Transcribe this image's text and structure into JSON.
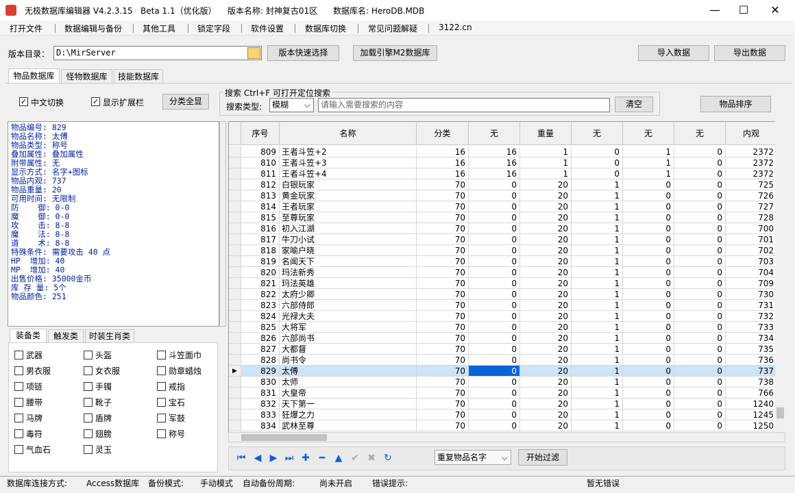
{
  "window": {
    "title": "无极数据库编辑器 V4.2.3.15",
    "beta": "Beta 1.1（优化版）",
    "version_name": "版本名称: 封神复古01区",
    "db_name": "数据库名: HeroDB.MDB",
    "min": "—",
    "max": "☐",
    "close": "✕"
  },
  "menu": [
    "打开文件",
    "数据编辑与备份",
    "其他工具",
    "锁定字段",
    "软件设置",
    "数据库切换",
    "常见问题解疑",
    "3122.cn"
  ],
  "toolbar": {
    "dir_label": "版本目录：",
    "dir_value": "D:\\MirServer",
    "quick_select": "版本快速选择",
    "load_m2": "加载引擎M2数据库",
    "import": "导入数据",
    "export": "导出数据"
  },
  "tabs": [
    "物品数据库",
    "怪物数据库",
    "技能数据库"
  ],
  "options": {
    "chinese": "中文切换",
    "ext": "显示扩展栏",
    "category_all": "分类全显"
  },
  "search": {
    "group_title": "搜索  Ctrl+F 可打开定位搜索",
    "type_label": "搜索类型:",
    "type_value": "模糊",
    "placeholder": "请输入需要搜索的内容",
    "clear": "清空",
    "sort": "物品排序"
  },
  "info_lines": [
    "物品编号: 829",
    "物品名称: 太傅",
    "物品类型: 称号",
    "叠加属性: 叠加属性",
    "附带属性: 无",
    "显示方式: 名字+图标",
    "物品内观: 737",
    "物品重量: 20",
    "可用时间: 无限制",
    "防    御: 0-0",
    "魔    御: 0-0",
    "攻    击: 8-8",
    "魔    法: 8-8",
    "道    术: 8-8",
    "特殊条件: 需要攻击 40 点",
    "HP  增加: 40",
    "MP  增加: 40",
    "出售价格: 35000金币",
    "库 存 量: 5个",
    "物品颜色: 251"
  ],
  "cat_tabs": [
    "装备类",
    "触发类",
    "时装生肖类"
  ],
  "categories": [
    "武器",
    "头盔",
    "斗笠面巾",
    "男衣服",
    "女衣服",
    "勋章蜡烛",
    "项链",
    "手镯",
    "戒指",
    "腰带",
    "靴子",
    "宝石",
    "马牌",
    "盾牌",
    "军鼓",
    "毒符",
    "翅膀",
    "称号",
    "气血石",
    "灵玉"
  ],
  "grid": {
    "headers": [
      "序号",
      "名称",
      "分类",
      "无",
      "重量",
      "无",
      "无",
      "无",
      "内观"
    ],
    "rows": [
      [
        "809",
        "王者斗笠+2",
        "16",
        "16",
        "1",
        "0",
        "1",
        "0",
        "2372"
      ],
      [
        "810",
        "王者斗笠+3",
        "16",
        "16",
        "1",
        "0",
        "1",
        "0",
        "2372"
      ],
      [
        "811",
        "王者斗笠+4",
        "16",
        "16",
        "1",
        "0",
        "1",
        "0",
        "2372"
      ],
      [
        "812",
        "白银玩家",
        "70",
        "0",
        "20",
        "1",
        "0",
        "0",
        "725"
      ],
      [
        "813",
        "黄金玩家",
        "70",
        "0",
        "20",
        "1",
        "0",
        "0",
        "726"
      ],
      [
        "814",
        "王者玩家",
        "70",
        "0",
        "20",
        "1",
        "0",
        "0",
        "727"
      ],
      [
        "815",
        "至尊玩家",
        "70",
        "0",
        "20",
        "1",
        "0",
        "0",
        "728"
      ],
      [
        "816",
        "初入江湖",
        "70",
        "0",
        "20",
        "1",
        "0",
        "0",
        "700"
      ],
      [
        "817",
        "牛刀小试",
        "70",
        "0",
        "20",
        "1",
        "0",
        "0",
        "701"
      ],
      [
        "818",
        "家喻户晓",
        "70",
        "0",
        "20",
        "1",
        "0",
        "0",
        "702"
      ],
      [
        "819",
        "名闻天下",
        "70",
        "0",
        "20",
        "1",
        "0",
        "0",
        "703"
      ],
      [
        "820",
        "玛法新秀",
        "70",
        "0",
        "20",
        "1",
        "0",
        "0",
        "704"
      ],
      [
        "821",
        "玛法英雄",
        "70",
        "0",
        "20",
        "1",
        "0",
        "0",
        "709"
      ],
      [
        "822",
        "太府少卿",
        "70",
        "0",
        "20",
        "1",
        "0",
        "0",
        "730"
      ],
      [
        "823",
        "六部侍郎",
        "70",
        "0",
        "20",
        "1",
        "0",
        "0",
        "731"
      ],
      [
        "824",
        "光禄大夫",
        "70",
        "0",
        "20",
        "1",
        "0",
        "0",
        "732"
      ],
      [
        "825",
        "大将军",
        "70",
        "0",
        "20",
        "1",
        "0",
        "0",
        "733"
      ],
      [
        "826",
        "六部尚书",
        "70",
        "0",
        "20",
        "1",
        "0",
        "0",
        "734"
      ],
      [
        "827",
        "大都督",
        "70",
        "0",
        "20",
        "1",
        "0",
        "0",
        "735"
      ],
      [
        "828",
        "尚书令",
        "70",
        "0",
        "20",
        "1",
        "0",
        "0",
        "736"
      ],
      [
        "829",
        "太傅",
        "70",
        "0",
        "20",
        "1",
        "0",
        "0",
        "737"
      ],
      [
        "830",
        "太师",
        "70",
        "0",
        "20",
        "1",
        "0",
        "0",
        "738"
      ],
      [
        "831",
        "大皇帝",
        "70",
        "0",
        "20",
        "1",
        "0",
        "0",
        "766"
      ],
      [
        "832",
        "天下第一",
        "70",
        "0",
        "20",
        "1",
        "0",
        "0",
        "1240"
      ],
      [
        "833",
        "狂爆之力",
        "70",
        "0",
        "20",
        "1",
        "0",
        "0",
        "1245"
      ],
      [
        "834",
        "武林至尊",
        "70",
        "0",
        "20",
        "1",
        "0",
        "0",
        "1250"
      ]
    ],
    "selected_index": 20
  },
  "bottom": {
    "filter_select": "重复物品名字",
    "filter_btn": "开始过滤"
  },
  "status": {
    "conn_label": "数据库连接方式:",
    "conn_value": "Access数据库",
    "backup_label": "备份模式:",
    "backup_value": "手动模式",
    "auto_label": "自动备份周期:",
    "auto_value": "尚未开启",
    "err_label": "错误提示:",
    "err_value": "暂无错误"
  },
  "colors": {
    "selected_row": "#cde3f8",
    "current_cell": "#0a64d8",
    "info_text": "#001f9e",
    "nav_blue": "#1060d0"
  }
}
